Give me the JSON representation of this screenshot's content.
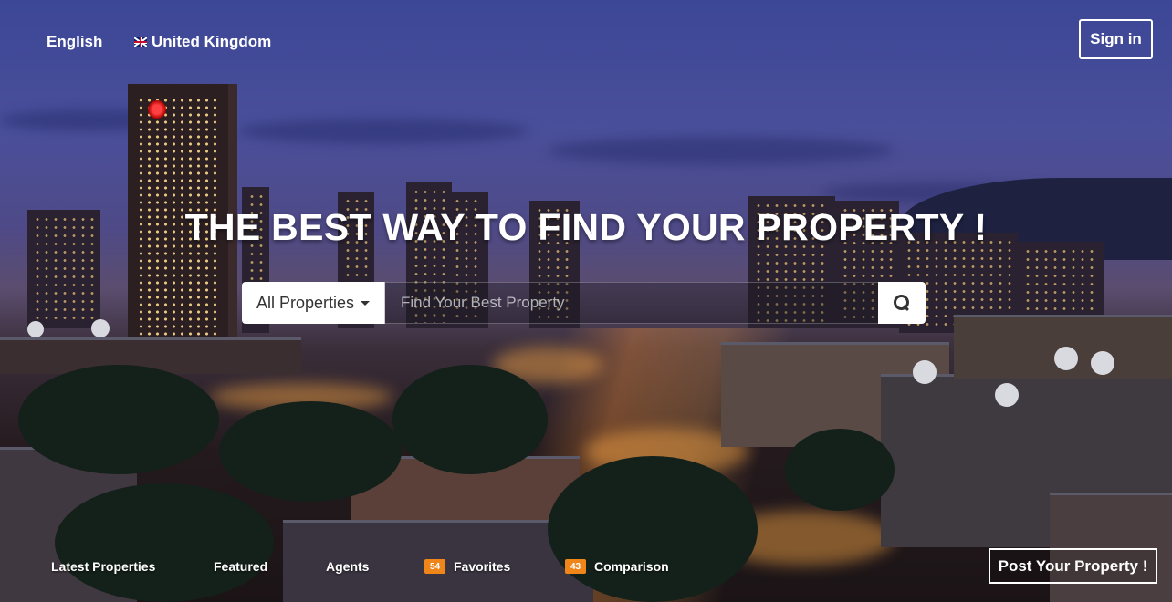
{
  "topbar": {
    "language": "English",
    "country": "United Kingdom",
    "flag_icon": "uk-flag-icon",
    "signin_label": "Sign in"
  },
  "hero": {
    "title": "THE BEST WAY TO FIND YOUR PROPERTY !"
  },
  "search": {
    "category_selected": "All Properties",
    "placeholder": "Find Your Best Property",
    "button_icon": "search-icon"
  },
  "nav": {
    "latest": "Latest Properties",
    "featured": "Featured",
    "agents": "Agents",
    "favorites": "Favorites",
    "favorites_count": "54",
    "comparison": "Comparison",
    "comparison_count": "43"
  },
  "post_property_label": "Post Your Property !",
  "colors": {
    "badge": "#f0861a",
    "text": "#ffffff"
  }
}
